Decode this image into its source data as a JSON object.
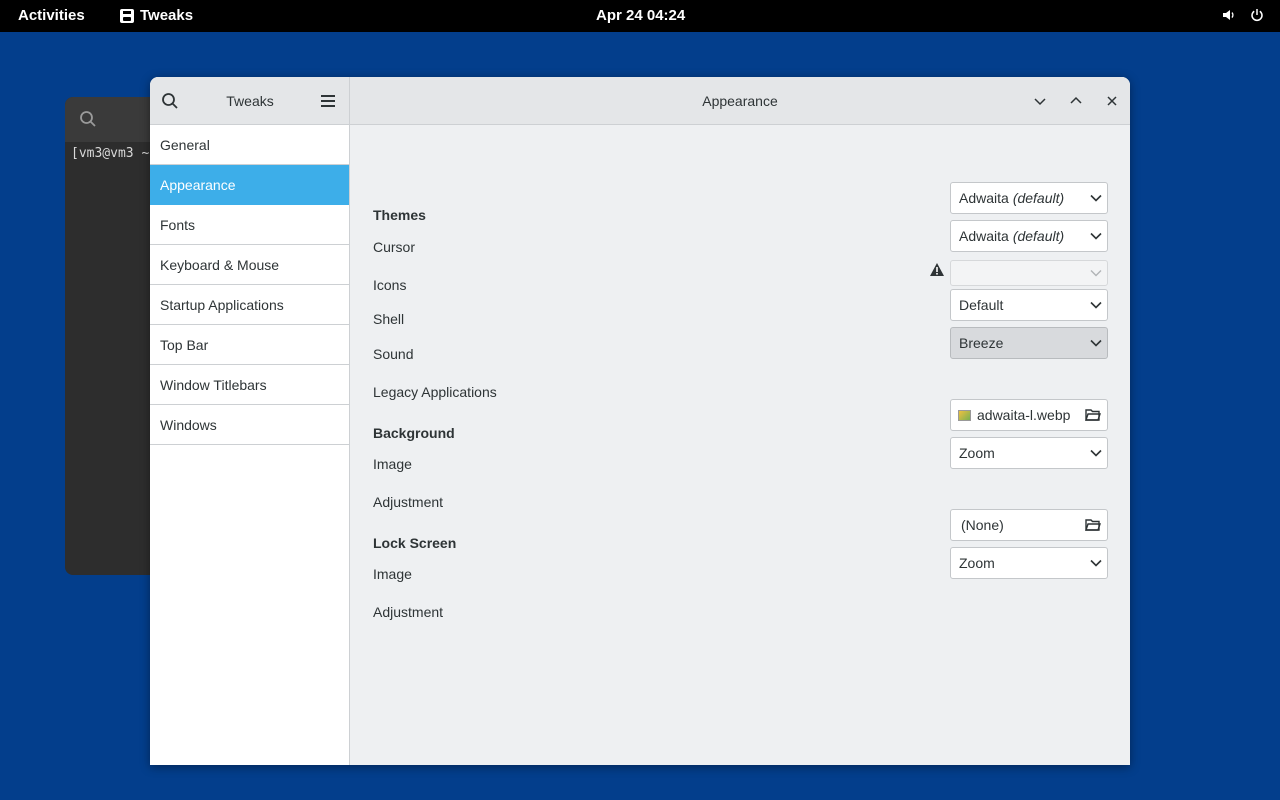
{
  "topbar": {
    "activities": "Activities",
    "app_name": "Tweaks",
    "clock": "Apr 24  04:24",
    "icons": [
      "volume-icon",
      "power-icon"
    ]
  },
  "terminal": {
    "prompt_text": "[vm3@vm3 ~"
  },
  "window": {
    "sidebar_title": "Tweaks",
    "page_title": "Appearance"
  },
  "sidebar": {
    "items": [
      {
        "label": "General"
      },
      {
        "label": "Appearance"
      },
      {
        "label": "Fonts"
      },
      {
        "label": "Keyboard & Mouse"
      },
      {
        "label": "Startup Applications"
      },
      {
        "label": "Top Bar"
      },
      {
        "label": "Window Titlebars"
      },
      {
        "label": "Windows"
      }
    ],
    "selected": "Appearance"
  },
  "themes": {
    "title": "Themes",
    "cursor": {
      "label": "Cursor",
      "value": "Adwaita",
      "suffix": "(default)"
    },
    "icons": {
      "label": "Icons",
      "value": "Adwaita",
      "suffix": "(default)"
    },
    "shell": {
      "label": "Shell",
      "value": ""
    },
    "sound": {
      "label": "Sound",
      "value": "Default"
    },
    "legacy": {
      "label": "Legacy Applications",
      "value": "Breeze"
    }
  },
  "background": {
    "title": "Background",
    "image": {
      "label": "Image",
      "value": "adwaita-l.webp"
    },
    "adjustment": {
      "label": "Adjustment",
      "value": "Zoom"
    }
  },
  "lockscreen": {
    "title": "Lock Screen",
    "image": {
      "label": "Image",
      "value": "(None)"
    },
    "adjustment": {
      "label": "Adjustment",
      "value": "Zoom"
    }
  },
  "colors": {
    "desktop": "#033e8c",
    "accent": "#3daee9"
  }
}
